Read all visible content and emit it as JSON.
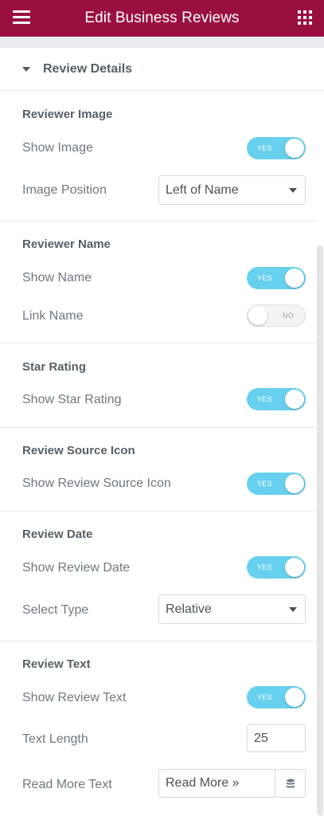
{
  "header": {
    "title": "Edit Business Reviews",
    "bg_color": "#9a0f42",
    "menu_icon": "hamburger-icon",
    "apps_icon": "grid-icon"
  },
  "section": {
    "label": "Review Details",
    "expanded": true
  },
  "toggle_on_color": "#67d0ef",
  "groups": {
    "reviewer_image": {
      "title": "Reviewer Image",
      "show_image": {
        "label": "Show Image",
        "state": "YES"
      },
      "image_position": {
        "label": "Image Position",
        "value": "Left of Name"
      }
    },
    "reviewer_name": {
      "title": "Reviewer Name",
      "show_name": {
        "label": "Show Name",
        "state": "YES"
      },
      "link_name": {
        "label": "Link Name",
        "state": "NO"
      }
    },
    "star_rating": {
      "title": "Star Rating",
      "show_star_rating": {
        "label": "Show Star Rating",
        "state": "YES"
      }
    },
    "review_source_icon": {
      "title": "Review Source Icon",
      "show_source_icon": {
        "label": "Show Review Source Icon",
        "state": "YES"
      }
    },
    "review_date": {
      "title": "Review Date",
      "show_review_date": {
        "label": "Show Review Date",
        "state": "YES"
      },
      "select_type": {
        "label": "Select Type",
        "value": "Relative"
      }
    },
    "review_text": {
      "title": "Review Text",
      "show_review_text": {
        "label": "Show Review Text",
        "state": "YES"
      },
      "text_length": {
        "label": "Text Length",
        "value": "25"
      },
      "read_more_text": {
        "label": "Read More Text",
        "value": "Read More »",
        "dynamic_icon": "database-icon"
      }
    }
  }
}
